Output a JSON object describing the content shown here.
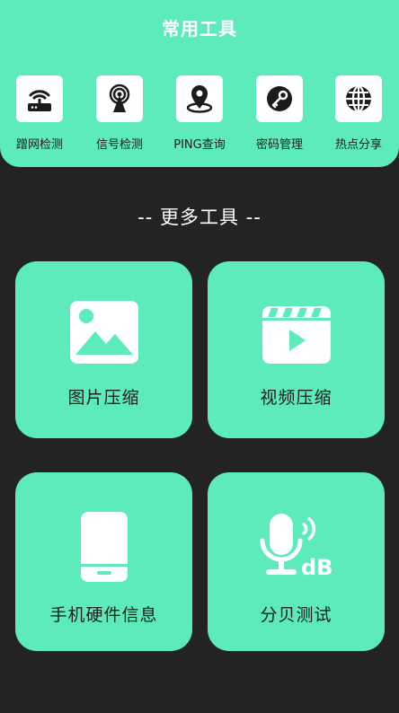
{
  "header": {
    "title": "常用工具"
  },
  "tools": [
    {
      "label": "蹭网检测",
      "icon": "router-icon"
    },
    {
      "label": "信号检测",
      "icon": "signal-tower-icon"
    },
    {
      "label": "PING查询",
      "icon": "map-pin-icon"
    },
    {
      "label": "密码管理",
      "icon": "key-icon"
    },
    {
      "label": "热点分享",
      "icon": "globe-icon"
    }
  ],
  "section": {
    "title": "-- 更多工具 --"
  },
  "cards": [
    {
      "label": "图片压缩",
      "icon": "image-icon"
    },
    {
      "label": "视频压缩",
      "icon": "video-icon"
    },
    {
      "label": "手机硬件信息",
      "icon": "phone-icon"
    },
    {
      "label": "分贝测试",
      "icon": "microphone-db-icon",
      "icon_text": "dB"
    }
  ],
  "colors": {
    "accent": "#5CEBB9",
    "background": "#232323",
    "icon_dark": "#1b1b1b"
  }
}
